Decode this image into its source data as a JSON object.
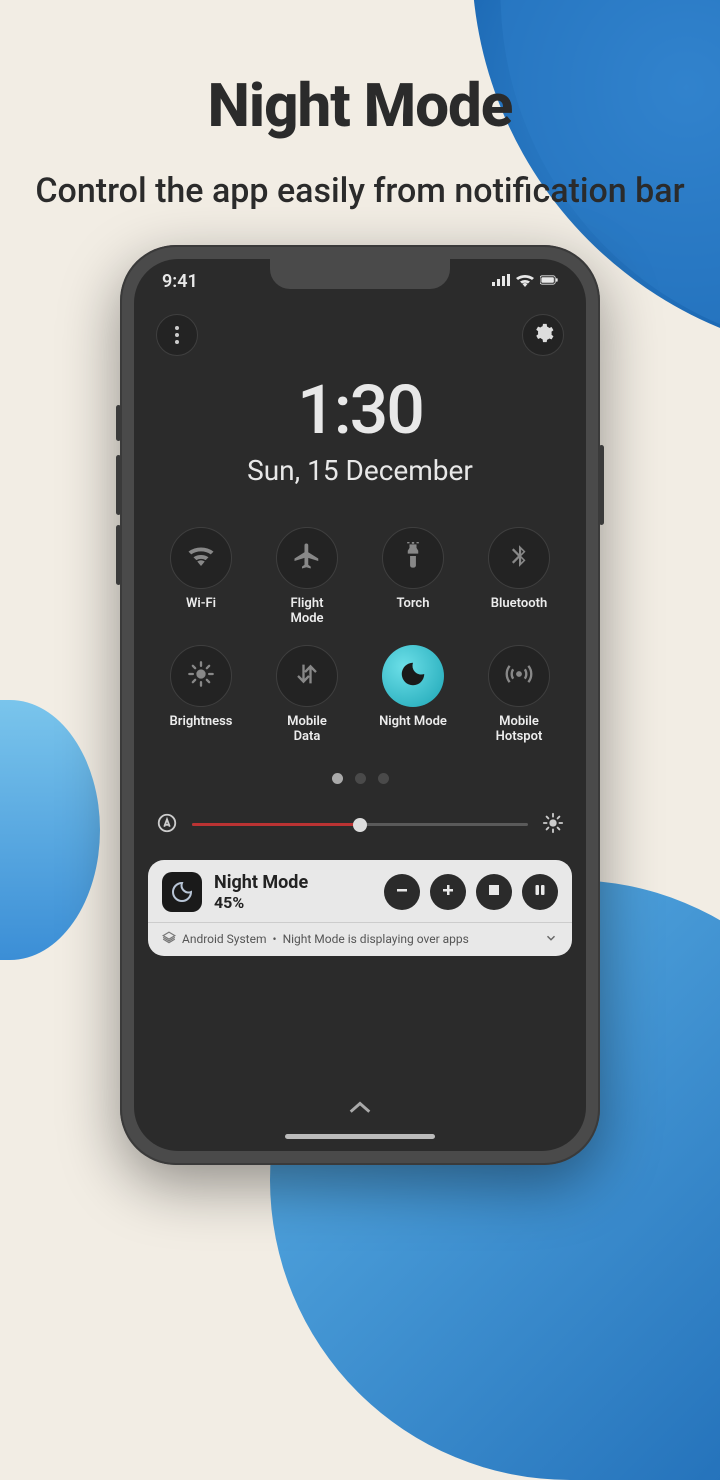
{
  "page": {
    "title": "Night Mode",
    "subtitle": "Control the app easily from notification bar"
  },
  "statusbar": {
    "time": "9:41"
  },
  "clock": {
    "time": "1:30",
    "date": "Sun, 15 December"
  },
  "qs": [
    {
      "label": "Wi-Fi"
    },
    {
      "label": "Flight\nMode"
    },
    {
      "label": "Torch"
    },
    {
      "label": "Bluetooth"
    },
    {
      "label": "Brightness"
    },
    {
      "label": "Mobile\nData"
    },
    {
      "label": "Night Mode"
    },
    {
      "label": "Mobile\nHotspot"
    }
  ],
  "notif": {
    "title": "Night Mode",
    "value": "45%",
    "footer_source": "Android System",
    "footer_msg": "Night Mode is displaying over apps"
  }
}
